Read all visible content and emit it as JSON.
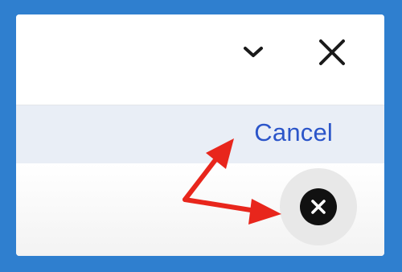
{
  "toolbar": {
    "collapse_icon": "chevron-down-icon",
    "close_icon": "close-icon"
  },
  "cancel_row": {
    "cancel_label": "Cancel"
  },
  "fab": {
    "icon": "close-circle-icon"
  },
  "annotation": {
    "arrow_color": "#e8261c"
  },
  "colors": {
    "frame": "#2f7fcf",
    "link": "#2b55c9",
    "cancel_row_bg": "#e9eef6"
  }
}
